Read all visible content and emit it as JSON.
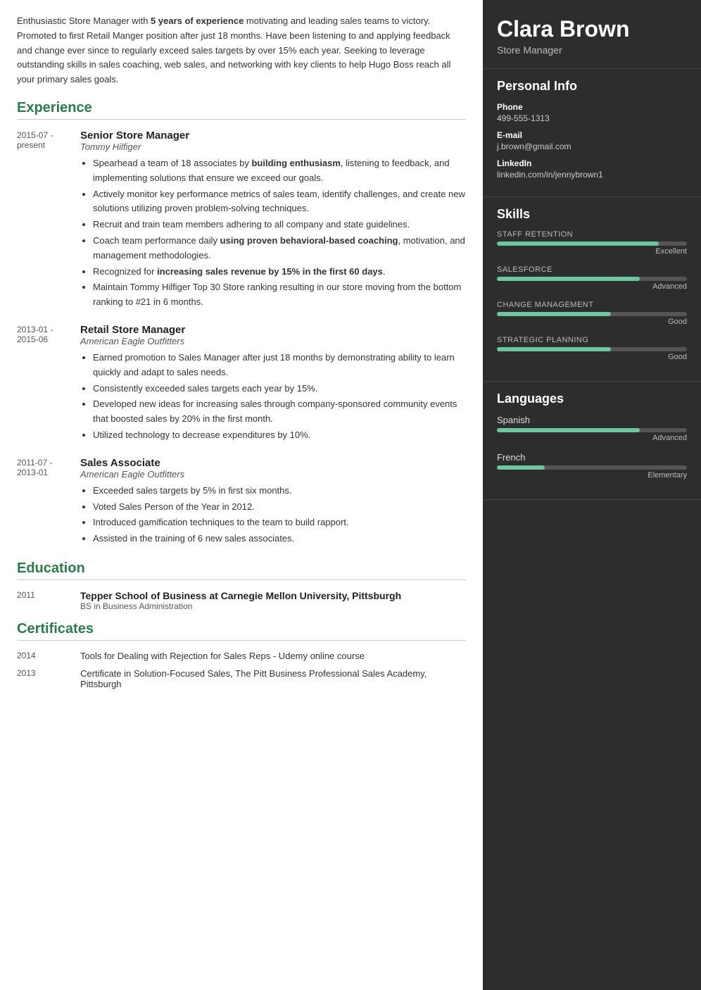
{
  "name": "Clara Brown",
  "role": "Store Manager",
  "summary": "Enthusiastic Store Manager with 5 years of experience motivating and leading sales teams to victory. Promoted to first Retail Manger position after just 18 months. Have been listening to and applying feedback and change ever since to regularly exceed sales targets by over 15% each year. Seeking to leverage outstanding skills in sales coaching, web sales, and networking with key clients to help Hugo Boss reach all your primary sales goals.",
  "personal_info": {
    "label": "Personal Info",
    "phone_label": "Phone",
    "phone": "499-555-1313",
    "email_label": "E-mail",
    "email": "j.brown@gmail.com",
    "linkedin_label": "LinkedIn",
    "linkedin": "linkedin.com/in/jennybrown1"
  },
  "skills": {
    "label": "Skills",
    "items": [
      {
        "name": "STAFF RETENTION",
        "level_label": "Excellent",
        "percent": 85
      },
      {
        "name": "SALESFORCE",
        "level_label": "Advanced",
        "percent": 75
      },
      {
        "name": "CHANGE MANAGEMENT",
        "level_label": "Good",
        "percent": 60
      },
      {
        "name": "STRATEGIC PLANNING",
        "level_label": "Good",
        "percent": 60
      }
    ]
  },
  "languages": {
    "label": "Languages",
    "items": [
      {
        "name": "Spanish",
        "level_label": "Advanced",
        "percent": 75
      },
      {
        "name": "French",
        "level_label": "Elementary",
        "percent": 25
      }
    ]
  },
  "experience": {
    "label": "Experience",
    "items": [
      {
        "date": "2015-07 - present",
        "title": "Senior Store Manager",
        "company": "Tommy Hilfiger",
        "bullets": [
          "Spearhead a team of 18 associates by building enthusiasm, listening to feedback, and implementing solutions that ensure we exceed our goals.",
          "Actively monitor key performance metrics of sales team, identify challenges, and create new solutions utilizing proven problem-solving techniques.",
          "Recruit and train team members adhering to all company and state guidelines.",
          "Coach team performance daily using proven behavioral-based coaching, motivation, and management methodologies.",
          "Recognized for increasing sales revenue by 15% in the first 60 days.",
          "Maintain Tommy Hilfiger Top 30 Store ranking resulting in our store moving from the bottom ranking to #21 in 6 months."
        ]
      },
      {
        "date": "2013-01 - 2015-06",
        "title": "Retail Store Manager",
        "company": "American Eagle Outfitters",
        "bullets": [
          "Earned promotion to Sales Manager after just 18 months by demonstrating ability to learn quickly and adapt to sales needs.",
          "Consistently exceeded sales targets each year by 15%.",
          "Developed new ideas for increasing sales through company-sponsored community events that boosted sales by 20% in the first month.",
          "Utilized technology to decrease expenditures by 10%."
        ]
      },
      {
        "date": "2011-07 - 2013-01",
        "title": "Sales Associate",
        "company": "American Eagle Outfitters",
        "bullets": [
          "Exceeded sales targets by 5% in first six months.",
          "Voted Sales Person of the Year in 2012.",
          "Introduced gamification techniques to the team to build rapport.",
          "Assisted in the training of 6 new sales associates."
        ]
      }
    ]
  },
  "education": {
    "label": "Education",
    "items": [
      {
        "year": "2011",
        "school": "Tepper School of Business at Carnegie Mellon University, Pittsburgh",
        "degree": "BS in Business Administration"
      }
    ]
  },
  "certificates": {
    "label": "Certificates",
    "items": [
      {
        "year": "2014",
        "text": "Tools for Dealing with Rejection for Sales Reps - Udemy online course"
      },
      {
        "year": "2013",
        "text": "Certificate in Solution-Focused Sales, The Pitt Business Professional Sales Academy, Pittsburgh"
      }
    ]
  }
}
